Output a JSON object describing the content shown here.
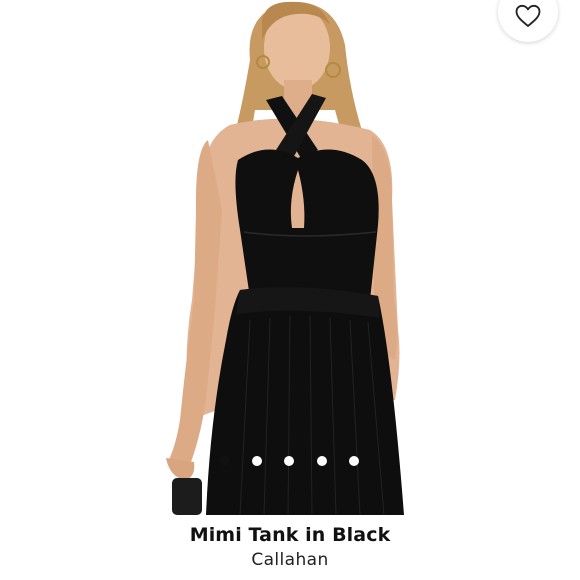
{
  "product": {
    "title": "Mimi Tank in Black",
    "brand": "Callahan"
  },
  "wishlist": {
    "icon": "heart-outline-icon"
  },
  "carousel": {
    "total_images": 5,
    "active_index": 0
  },
  "colors": {
    "background": "#ffffff",
    "garment": "#0e0e0e",
    "skin": "#e6b898",
    "hair": "#c79a62",
    "dot_active": "#111111",
    "dot_inactive": "#ffffff"
  }
}
